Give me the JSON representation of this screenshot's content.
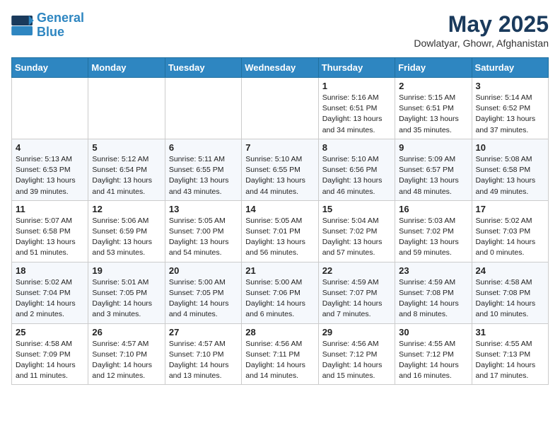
{
  "header": {
    "logo_line1": "General",
    "logo_line2": "Blue",
    "month": "May 2025",
    "location": "Dowlatyar, Ghowr, Afghanistan"
  },
  "weekdays": [
    "Sunday",
    "Monday",
    "Tuesday",
    "Wednesday",
    "Thursday",
    "Friday",
    "Saturday"
  ],
  "weeks": [
    [
      {
        "day": "",
        "info": ""
      },
      {
        "day": "",
        "info": ""
      },
      {
        "day": "",
        "info": ""
      },
      {
        "day": "",
        "info": ""
      },
      {
        "day": "1",
        "info": "Sunrise: 5:16 AM\nSunset: 6:51 PM\nDaylight: 13 hours\nand 34 minutes."
      },
      {
        "day": "2",
        "info": "Sunrise: 5:15 AM\nSunset: 6:51 PM\nDaylight: 13 hours\nand 35 minutes."
      },
      {
        "day": "3",
        "info": "Sunrise: 5:14 AM\nSunset: 6:52 PM\nDaylight: 13 hours\nand 37 minutes."
      }
    ],
    [
      {
        "day": "4",
        "info": "Sunrise: 5:13 AM\nSunset: 6:53 PM\nDaylight: 13 hours\nand 39 minutes."
      },
      {
        "day": "5",
        "info": "Sunrise: 5:12 AM\nSunset: 6:54 PM\nDaylight: 13 hours\nand 41 minutes."
      },
      {
        "day": "6",
        "info": "Sunrise: 5:11 AM\nSunset: 6:55 PM\nDaylight: 13 hours\nand 43 minutes."
      },
      {
        "day": "7",
        "info": "Sunrise: 5:10 AM\nSunset: 6:55 PM\nDaylight: 13 hours\nand 44 minutes."
      },
      {
        "day": "8",
        "info": "Sunrise: 5:10 AM\nSunset: 6:56 PM\nDaylight: 13 hours\nand 46 minutes."
      },
      {
        "day": "9",
        "info": "Sunrise: 5:09 AM\nSunset: 6:57 PM\nDaylight: 13 hours\nand 48 minutes."
      },
      {
        "day": "10",
        "info": "Sunrise: 5:08 AM\nSunset: 6:58 PM\nDaylight: 13 hours\nand 49 minutes."
      }
    ],
    [
      {
        "day": "11",
        "info": "Sunrise: 5:07 AM\nSunset: 6:58 PM\nDaylight: 13 hours\nand 51 minutes."
      },
      {
        "day": "12",
        "info": "Sunrise: 5:06 AM\nSunset: 6:59 PM\nDaylight: 13 hours\nand 53 minutes."
      },
      {
        "day": "13",
        "info": "Sunrise: 5:05 AM\nSunset: 7:00 PM\nDaylight: 13 hours\nand 54 minutes."
      },
      {
        "day": "14",
        "info": "Sunrise: 5:05 AM\nSunset: 7:01 PM\nDaylight: 13 hours\nand 56 minutes."
      },
      {
        "day": "15",
        "info": "Sunrise: 5:04 AM\nSunset: 7:02 PM\nDaylight: 13 hours\nand 57 minutes."
      },
      {
        "day": "16",
        "info": "Sunrise: 5:03 AM\nSunset: 7:02 PM\nDaylight: 13 hours\nand 59 minutes."
      },
      {
        "day": "17",
        "info": "Sunrise: 5:02 AM\nSunset: 7:03 PM\nDaylight: 14 hours\nand 0 minutes."
      }
    ],
    [
      {
        "day": "18",
        "info": "Sunrise: 5:02 AM\nSunset: 7:04 PM\nDaylight: 14 hours\nand 2 minutes."
      },
      {
        "day": "19",
        "info": "Sunrise: 5:01 AM\nSunset: 7:05 PM\nDaylight: 14 hours\nand 3 minutes."
      },
      {
        "day": "20",
        "info": "Sunrise: 5:00 AM\nSunset: 7:05 PM\nDaylight: 14 hours\nand 4 minutes."
      },
      {
        "day": "21",
        "info": "Sunrise: 5:00 AM\nSunset: 7:06 PM\nDaylight: 14 hours\nand 6 minutes."
      },
      {
        "day": "22",
        "info": "Sunrise: 4:59 AM\nSunset: 7:07 PM\nDaylight: 14 hours\nand 7 minutes."
      },
      {
        "day": "23",
        "info": "Sunrise: 4:59 AM\nSunset: 7:08 PM\nDaylight: 14 hours\nand 8 minutes."
      },
      {
        "day": "24",
        "info": "Sunrise: 4:58 AM\nSunset: 7:08 PM\nDaylight: 14 hours\nand 10 minutes."
      }
    ],
    [
      {
        "day": "25",
        "info": "Sunrise: 4:58 AM\nSunset: 7:09 PM\nDaylight: 14 hours\nand 11 minutes."
      },
      {
        "day": "26",
        "info": "Sunrise: 4:57 AM\nSunset: 7:10 PM\nDaylight: 14 hours\nand 12 minutes."
      },
      {
        "day": "27",
        "info": "Sunrise: 4:57 AM\nSunset: 7:10 PM\nDaylight: 14 hours\nand 13 minutes."
      },
      {
        "day": "28",
        "info": "Sunrise: 4:56 AM\nSunset: 7:11 PM\nDaylight: 14 hours\nand 14 minutes."
      },
      {
        "day": "29",
        "info": "Sunrise: 4:56 AM\nSunset: 7:12 PM\nDaylight: 14 hours\nand 15 minutes."
      },
      {
        "day": "30",
        "info": "Sunrise: 4:55 AM\nSunset: 7:12 PM\nDaylight: 14 hours\nand 16 minutes."
      },
      {
        "day": "31",
        "info": "Sunrise: 4:55 AM\nSunset: 7:13 PM\nDaylight: 14 hours\nand 17 minutes."
      }
    ]
  ]
}
